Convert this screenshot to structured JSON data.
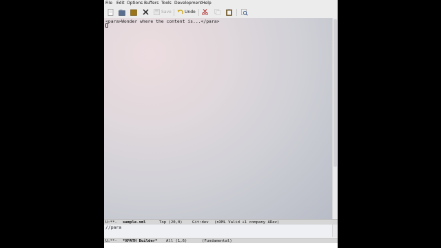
{
  "menubar": {
    "items": [
      "File",
      "Edit",
      "Options",
      "Buffers",
      "Tools",
      "Development",
      "Help"
    ]
  },
  "toolbar": {
    "save_label": "Save",
    "undo_label": "Undo"
  },
  "editor": {
    "line1": "<para>Wonder where the content is...</para>"
  },
  "modeline_main": {
    "status": "U:**-",
    "buffer_name": "sample.xml",
    "position": "Top (20,0)",
    "vc": "Git:dev",
    "modes": "(nXML Valid +1 company ARev)"
  },
  "minibuffer": {
    "text": "//para"
  },
  "modeline_xpath": {
    "status": "U:**-",
    "buffer_name": "*XPATH Builder*",
    "position": "All (1,6)",
    "modes": "(Fundamental)"
  },
  "colors": {
    "menubar_bg": "#ececec",
    "modeline_bg": "#d6d6d6"
  }
}
